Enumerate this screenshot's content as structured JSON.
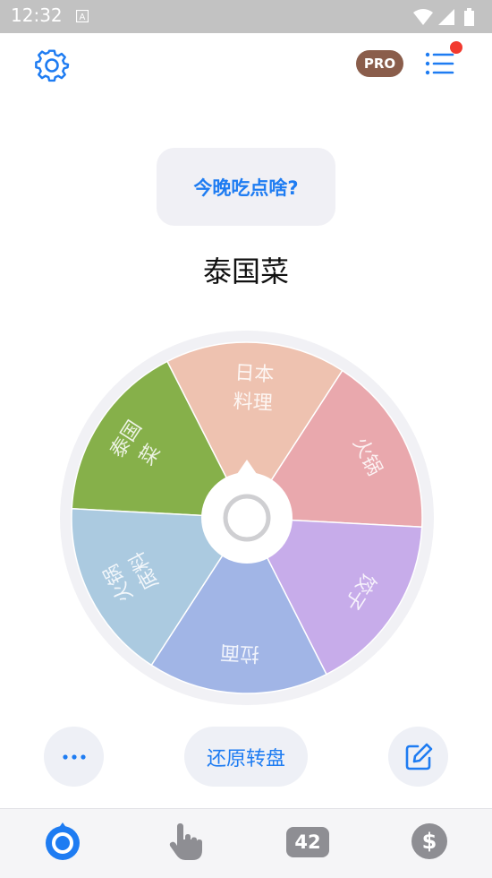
{
  "status_bar": {
    "time": "12:32",
    "notification_icon": "a-icon",
    "icons": [
      "wifi-icon",
      "signal-icon",
      "battery-icon"
    ]
  },
  "header": {
    "settings_icon": "gear-icon",
    "pro_badge": "PRO",
    "menu_icon": "list-icon",
    "menu_has_notification": true
  },
  "question": "今晚吃点啥?",
  "result": "泰国菜",
  "wheel": {
    "segments": [
      {
        "label_line1": "泰国",
        "label_line2": "菜",
        "color": "#86b04a"
      },
      {
        "label_line1": "日本",
        "label_line2": "料理",
        "color": "#eec2b0"
      },
      {
        "label_line1": "火锅",
        "label_line2": "",
        "color": "#e9a8ad"
      },
      {
        "label_line1": "饺子",
        "label_line2": "",
        "color": "#c7acea"
      },
      {
        "label_line1": "拉面",
        "label_line2": "",
        "color": "#a1b5e6"
      },
      {
        "label_line1": "火锅",
        "label_line2": "底料",
        "color": "#abcae0"
      }
    ]
  },
  "buttons": {
    "more_icon": "ellipsis-icon",
    "reset_label": "还原转盘",
    "edit_icon": "edit-icon"
  },
  "tabbar": {
    "wheel_icon": "wheel-icon",
    "touch_icon": "hand-pointer-icon",
    "number_label": "42",
    "dollar_icon": "dollar-icon"
  },
  "colors": {
    "accent": "#1e7cf2",
    "pro_badge": "#8a5d4b",
    "notification_dot": "#f23a2f"
  }
}
